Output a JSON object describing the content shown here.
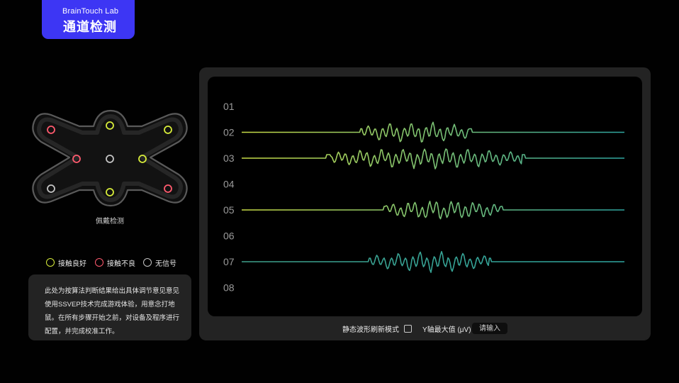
{
  "brand": {
    "subtitle": "BrainTouch Lab",
    "title": "通道检测"
  },
  "device": {
    "caption": "佩戴检测",
    "electrodes": [
      {
        "id": "e1",
        "status": "bad"
      },
      {
        "id": "e2",
        "status": "good"
      },
      {
        "id": "e3",
        "status": "good"
      },
      {
        "id": "e4",
        "status": "bad"
      },
      {
        "id": "e5",
        "status": "none"
      },
      {
        "id": "e6",
        "status": "good"
      },
      {
        "id": "e7",
        "status": "none"
      },
      {
        "id": "e8",
        "status": "good"
      },
      {
        "id": "e9",
        "status": "bad"
      }
    ]
  },
  "legend": [
    {
      "status": "good",
      "label": "接触良好",
      "color": "#d7ec3a"
    },
    {
      "status": "bad",
      "label": "接触不良",
      "color": "#ff5a6e"
    },
    {
      "status": "none",
      "label": "无信号",
      "color": "#c4c4c4"
    }
  ],
  "note": "此处为按算法判断结果给出具体调节意见意见使用SSVEP技术完成游戏体验，用意念打地鼠。在所有步骤开始之前，对设备及程序进行配置，并完成校准工作。",
  "channels": [
    {
      "label": "01",
      "color_start": "#c8dc46",
      "color_end": "#2fa6a0",
      "bursts": []
    },
    {
      "label": "02",
      "color_start": "#c8dc46",
      "color_end": "#2fa6a0",
      "bursts": [
        [
          0.31,
          0.6
        ]
      ]
    },
    {
      "label": "03",
      "color_start": "#c8dc46",
      "color_end": "#2fa6a0",
      "bursts": [
        [
          0.22,
          0.74
        ]
      ]
    },
    {
      "label": "04",
      "color_start": "#c8dc46",
      "color_end": "#2fa6a0",
      "bursts": []
    },
    {
      "label": "05",
      "color_start": "#c8dc46",
      "color_end": "#2fa6a0",
      "bursts": [
        [
          0.37,
          0.68
        ]
      ]
    },
    {
      "label": "06",
      "color_start": "#c8dc46",
      "color_end": "#2fa6a0",
      "bursts": []
    },
    {
      "label": "07",
      "color_start": "#3fa08a",
      "color_end": "#2fa6a0",
      "bursts": [
        [
          0.33,
          0.65
        ]
      ]
    },
    {
      "label": "08",
      "color_start": "#303030",
      "color_end": "#303030",
      "bursts": []
    }
  ],
  "controls": {
    "static_mode_label": "静态波形刷新模式",
    "ymax_label": "Y轴最大值 (μV)：",
    "ymax_placeholder": "请输入"
  },
  "colors": {
    "accent": "#3d36f4",
    "panel": "#232323",
    "background": "#010101"
  }
}
